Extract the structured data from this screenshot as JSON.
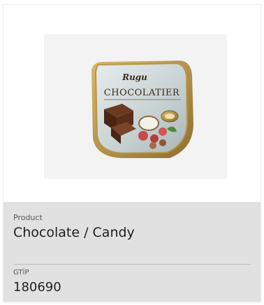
{
  "card": {
    "image": {
      "brand_text": "Rugu",
      "title_text": "CHOCOLATIER"
    },
    "product_label": "Product",
    "product_value": "Chocolate / Candy",
    "gtip_label": "GTİP",
    "gtip_value": "180690"
  }
}
